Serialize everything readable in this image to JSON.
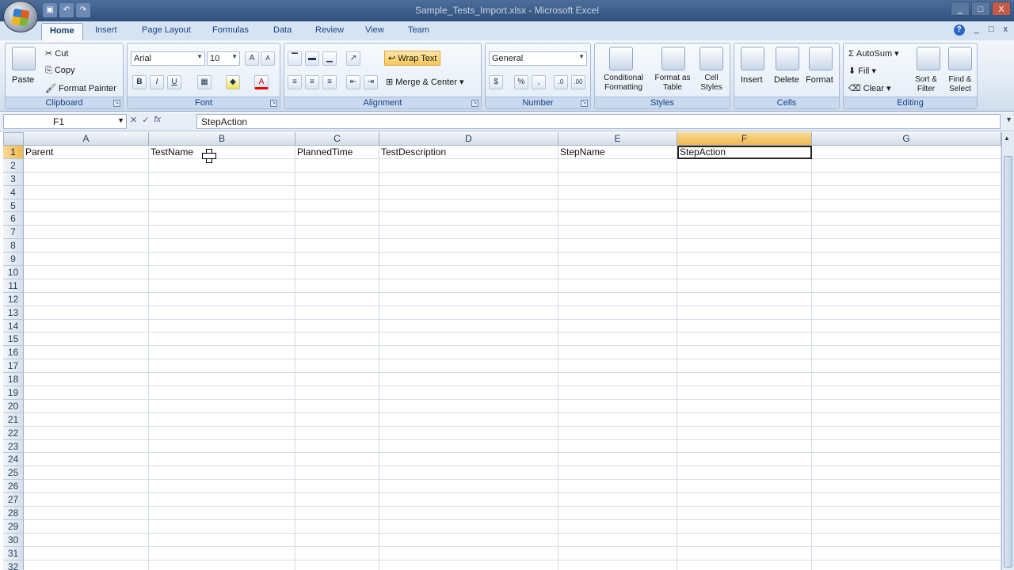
{
  "window": {
    "title": "Sample_Tests_Import.xlsx - Microsoft Excel",
    "controls": [
      "_",
      "□",
      "X"
    ]
  },
  "qat": [
    "save",
    "undo",
    "redo"
  ],
  "tabs": [
    "Home",
    "Insert",
    "Page Layout",
    "Formulas",
    "Data",
    "Review",
    "View",
    "Team"
  ],
  "ribbon": {
    "clipboard": {
      "label": "Clipboard",
      "paste": "Paste",
      "cut": "Cut",
      "copy": "Copy",
      "format_painter": "Format Painter"
    },
    "font": {
      "label": "Font",
      "name": "Arial",
      "size": "10",
      "bold": "B",
      "italic": "I",
      "underline": "U"
    },
    "alignment": {
      "label": "Alignment",
      "wrap_text": "Wrap Text",
      "merge_center": "Merge & Center"
    },
    "number": {
      "label": "Number",
      "format": "General",
      "percent": "%",
      "comma": ","
    },
    "styles": {
      "label": "Styles",
      "conditional": "Conditional Formatting",
      "format_table": "Format as Table",
      "cell_styles": "Cell Styles"
    },
    "cells": {
      "label": "Cells",
      "insert": "Insert",
      "delete": "Delete",
      "format": "Format"
    },
    "editing": {
      "label": "Editing",
      "autosum": "AutoSum",
      "fill": "Fill",
      "clear": "Clear",
      "sort_filter": "Sort & Filter",
      "find_select": "Find & Select"
    }
  },
  "formula_bar": {
    "name_box": "F1",
    "value": "StepAction"
  },
  "sheet": {
    "columns": [
      "A",
      "B",
      "C",
      "D",
      "E",
      "F",
      "G"
    ],
    "selected_column": "F",
    "row_numbers": [
      "1",
      "2",
      "3",
      "4",
      "5",
      "6",
      "7",
      "8",
      "9",
      "10",
      "11",
      "12",
      "13",
      "14",
      "15",
      "16",
      "17",
      "18",
      "19",
      "20",
      "21",
      "22",
      "23",
      "24",
      "25",
      "26",
      "27",
      "28",
      "29",
      "30",
      "31",
      "32"
    ],
    "row1": [
      "Parent",
      "TestName",
      "PlannedTime",
      "TestDescription",
      "StepName",
      "StepAction",
      ""
    ],
    "active_cell": "F1"
  }
}
